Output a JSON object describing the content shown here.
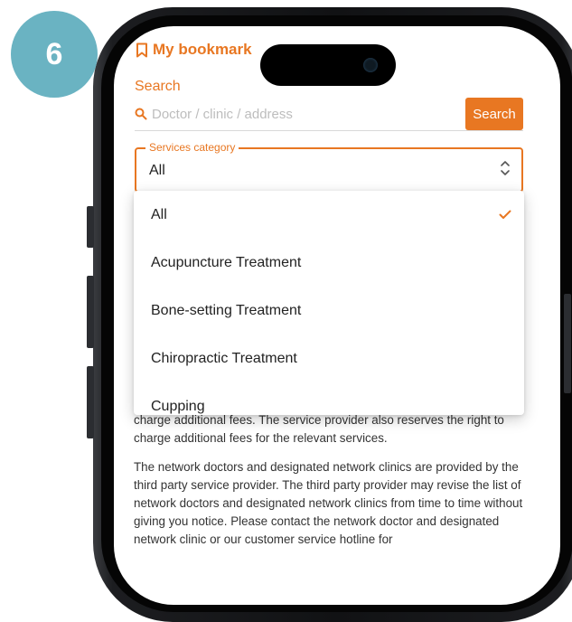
{
  "step_badge": "6",
  "header": {
    "title": "My bookmark",
    "icon": "bookmark-icon"
  },
  "search": {
    "label": "Search",
    "placeholder": "Doctor / clinic / address",
    "value": "",
    "button_label": "Search",
    "icon": "search-icon"
  },
  "category": {
    "legend": "Services category",
    "selected": "All",
    "icon": "select-arrows-icon"
  },
  "dropdown": {
    "options": [
      {
        "label": "All",
        "selected": true
      },
      {
        "label": "Acupuncture Treatment",
        "selected": false
      },
      {
        "label": "Bone-setting Treatment",
        "selected": false
      },
      {
        "label": "Chiropractic Treatment",
        "selected": false
      },
      {
        "label": "Cupping",
        "selected": false
      }
    ]
  },
  "body": {
    "paragraph1": "medical advice of online doctors, online doctors reserve the right to charge additional fees. The service provider also reserves the right to charge additional fees for the relevant services.",
    "paragraph2": "The network doctors and designated network clinics are provided by the third party service provider. The third party provider may revise the list of network doctors and designated network clinics from time to time without giving you notice. Please contact the network doctor and designated network clinic or our customer service hotline for"
  },
  "colors": {
    "accent": "#e87722",
    "badge": "#6ab3c2",
    "text": "#333333",
    "placeholder": "#bdbdbd"
  }
}
